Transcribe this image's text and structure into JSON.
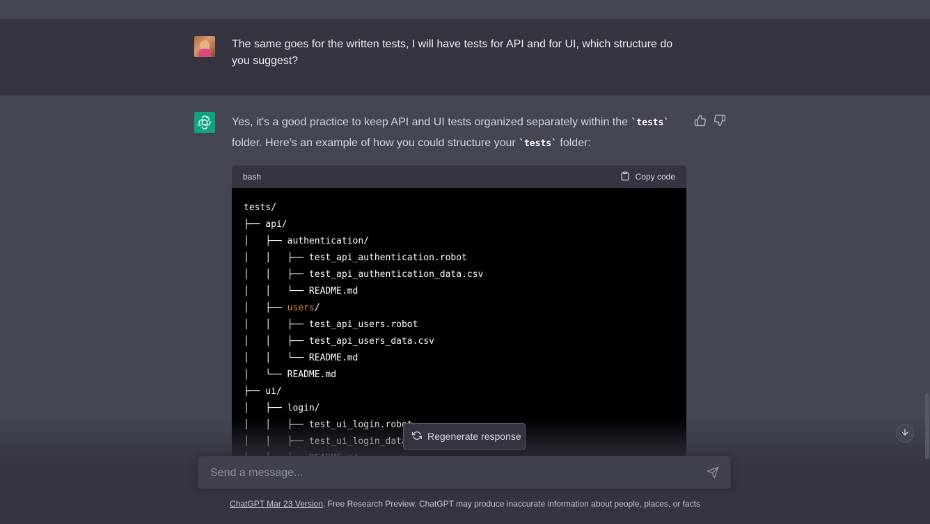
{
  "user_message": {
    "text": "The same goes for the written tests, I will have tests for API and for UI, which structure do you suggest?"
  },
  "assistant_message": {
    "intro_part1": "Yes, it's a good practice to keep API and UI tests organized separately within the ",
    "intro_code1": "`tests`",
    "intro_part2": " folder. Here's an example of how you could structure your ",
    "intro_code2": "`tests`",
    "intro_part3": " folder:",
    "feedback_icons": [
      "thumbs-up-icon",
      "thumbs-down-icon"
    ]
  },
  "code_block": {
    "language": "bash",
    "copy_label": "Copy code",
    "lines": [
      {
        "text": "tests/"
      },
      {
        "text": "├── api/"
      },
      {
        "text": "│   ├── authentication/"
      },
      {
        "text": "│   │   ├── test_api_authentication.robot"
      },
      {
        "text": "│   │   ├── test_api_authentication_data.csv"
      },
      {
        "text": "│   │   └── README.md"
      },
      {
        "prefix": "│   ├── ",
        "highlight": "users",
        "suffix": "/"
      },
      {
        "text": "│   │   ├── test_api_users.robot"
      },
      {
        "text": "│   │   ├── test_api_users_data.csv"
      },
      {
        "text": "│   │   └── README.md"
      },
      {
        "text": "│   └── README.md"
      },
      {
        "text": "├── ui/"
      },
      {
        "text": "│   ├── login/"
      },
      {
        "text": "│   │   ├── test_ui_login.robot"
      },
      {
        "text": "│   │   ├── test_ui_login_data.csv"
      },
      {
        "text": "│   │   └── README.md"
      }
    ]
  },
  "regenerate": {
    "label": "Regenerate response"
  },
  "composer": {
    "placeholder": "Send a message..."
  },
  "footer": {
    "link_text": "ChatGPT Mar 23 Version",
    "rest_text": ". Free Research Preview. ChatGPT may produce inaccurate information about people, places, or facts"
  },
  "colors": {
    "user_row_bg": "#343541",
    "assistant_row_bg": "#444654",
    "gpt_avatar_bg": "#10a37f",
    "code_bg": "#000000",
    "highlight": "#df8a3f"
  }
}
